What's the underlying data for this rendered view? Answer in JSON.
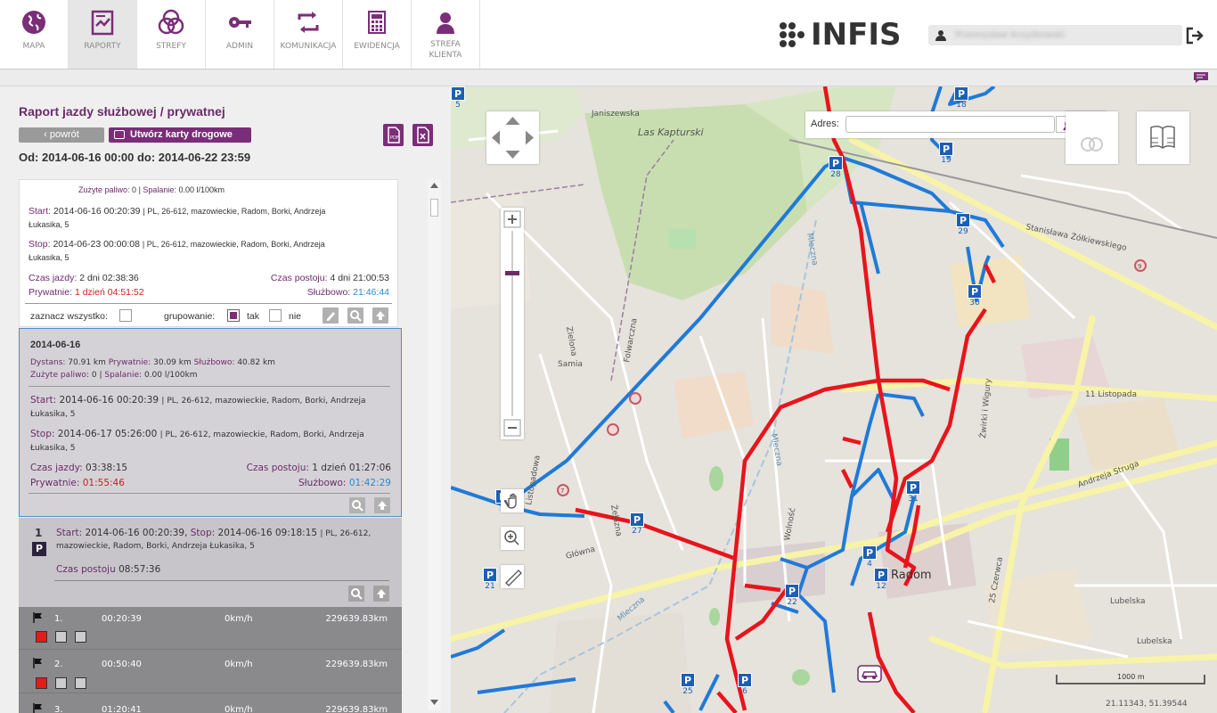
{
  "nav": {
    "items": [
      {
        "label": "MAPA",
        "icon": "globe-icon"
      },
      {
        "label": "RAPORTY",
        "icon": "report-icon",
        "active": true
      },
      {
        "label": "STREFY",
        "icon": "zones-icon"
      },
      {
        "label": "ADMIN",
        "icon": "key-icon"
      },
      {
        "label": "KOMUNIKACJA",
        "icon": "exchange-icon"
      },
      {
        "label": "EWIDENCJA",
        "icon": "calculator-icon"
      },
      {
        "label": "STREFA\nKLIENTA",
        "icon": "user-icon"
      }
    ],
    "logo_text": "INFIS",
    "user_name": "Przemysław Krzyżkowski"
  },
  "report": {
    "title": "Raport jazdy służbowej / prywatnej",
    "back_label": "‹ powrót",
    "cards_label": "Utwórz karty drogowe",
    "date_range": "Od: 2014-06-16 00:00 do: 2014-06-22 23:59"
  },
  "summary": {
    "fuel_label": "Zużyte paliwo:",
    "fuel_value": "0",
    "burn_label": "Spalanie:",
    "burn_value": "0.00 l/100km",
    "start_label": "Start:",
    "start_value": "2014-06-16 00:20:39",
    "start_addr": "PL, 26-612, mazowieckie, Radom, Borki, Andrzeja",
    "start_addr2": "Łukasika, 5",
    "stop_label": "Stop:",
    "stop_value": "2014-06-23 00:00:08",
    "stop_addr": "PL, 26-612, mazowieckie, Radom, Borki, Andrzeja",
    "stop_addr2": "Łukasika, 5",
    "drive_label": "Czas jazdy:",
    "drive_value": "2 dni 02:38:36",
    "park_label": "Czas postoju:",
    "park_value": "4 dni 21:00:53",
    "private_label": "Prywatnie:",
    "private_value": "1 dzień 04:51:52",
    "business_label": "Służbowo:",
    "business_value": "21:46:44",
    "select_all": "zaznacz wszystko:",
    "grouping": "grupowanie:",
    "yes": "tak",
    "no": "nie"
  },
  "day": {
    "date": "2014-06-16",
    "dist_label": "Dystans:",
    "dist_value": "70.91 km",
    "priv_label": "Prywatnie:",
    "priv_value": "30.09 km",
    "bus_label": "Służbowo:",
    "bus_value": "40.82 km",
    "fuel_label": "Zużyte paliwo:",
    "fuel_value": "0",
    "burn_label": "Spalanie:",
    "burn_value": "0.00 l/100km",
    "start_label": "Start:",
    "start_value": "2014-06-16 00:20:39",
    "start_addr": "PL, 26-612, mazowieckie, Radom, Borki, Andrzeja",
    "start_addr2": "Łukasika, 5",
    "stop_label": "Stop:",
    "stop_value": "2014-06-17 05:26:00",
    "stop_addr": "PL, 26-612, mazowieckie, Radom, Borki, Andrzeja",
    "stop_addr2": "Łukasika, 5",
    "drive_label": "Czas jazdy:",
    "drive_value": "03:38:15",
    "park_label": "Czas postoju:",
    "park_value": "1 dzień 01:27:06",
    "private_label": "Prywatnie:",
    "private_value": "01:55:46",
    "business_label": "Służbowo:",
    "business_value": "01:42:29"
  },
  "stop_entry": {
    "number": "1",
    "badge": "P",
    "start_label": "Start:",
    "start_value": "2014-06-16 00:20:39,",
    "stop_label": "Stop:",
    "stop_value": "2014-06-16 09:18:15",
    "addr": "| PL, 26-612,",
    "addr2": "mazowieckie, Radom, Borki, Andrzeja Łukasika, 5",
    "park_label": "Czas postoju",
    "park_value": "08:57:36"
  },
  "rows": [
    {
      "num": "1.",
      "time": "00:20:39",
      "speed": "0km/h",
      "odo": "229639.83km"
    },
    {
      "num": "2.",
      "time": "00:50:40",
      "speed": "0km/h",
      "odo": "229639.83km"
    },
    {
      "num": "3.",
      "time": "01:20:41",
      "speed": "0km/h",
      "odo": "229639.83km"
    }
  ],
  "map": {
    "address_label": "Adres:",
    "address_value": "",
    "city_label": "Radom",
    "scale_label": "1000 m",
    "coords": "21.11343, 51.39544",
    "streets": [
      "Janiszewska",
      "Las Kapturski",
      "Stanisława Żółkiewskiego",
      "Mleczna",
      "Zielona",
      "Samia",
      "Folwarczna",
      "11 Listopada",
      "Żwirki i Wigury",
      "Andrzeja Struga",
      "Listopadowa",
      "Główna",
      "Żelazna",
      "Wolność",
      "25 Czerwca",
      "Lubelska",
      "Zielona",
      "Mleczna"
    ],
    "markers": [
      "18",
      "19",
      "28",
      "29",
      "30",
      "31",
      "27",
      "21",
      "2",
      "4",
      "12",
      "22",
      "25",
      "6",
      "5"
    ]
  },
  "colors": {
    "accent": "#7a2e78",
    "private": "#d21b1b",
    "business": "#2a8ad0",
    "route_red": "#e8141c",
    "route_blue": "#1f7ad8"
  }
}
